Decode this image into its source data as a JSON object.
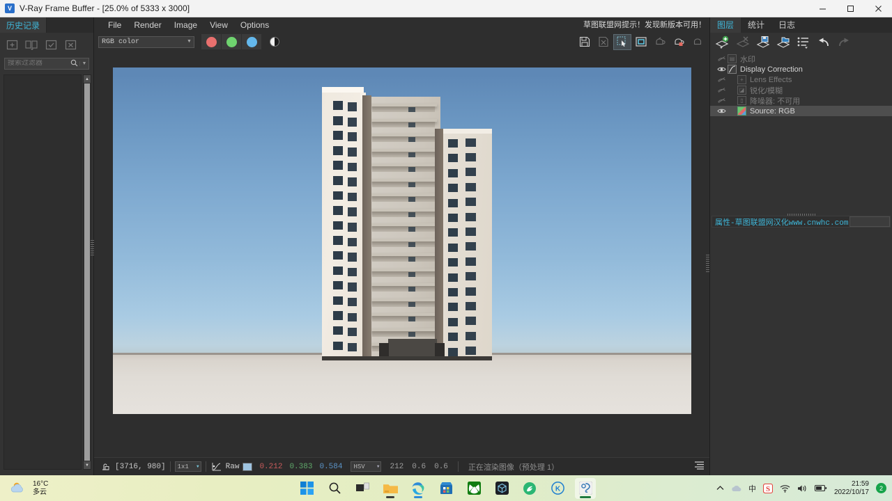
{
  "window": {
    "title": "V-Ray Frame Buffer - [25.0% of 5333 x 3000]",
    "icon": "vray-logo-icon",
    "minimize": "—",
    "maximize": "☐",
    "close": "✕"
  },
  "left_panel": {
    "tab_label": "历史记录",
    "toolbar": [
      {
        "name": "history-add",
        "glyph": "+"
      },
      {
        "name": "history-compare",
        "glyph": "A|B"
      },
      {
        "name": "history-check",
        "glyph": "✓"
      },
      {
        "name": "history-delete",
        "glyph": "✕"
      }
    ],
    "search_placeholder": "搜索过滤器",
    "search_value": ""
  },
  "menubar": {
    "items": [
      "File",
      "Render",
      "Image",
      "View",
      "Options"
    ],
    "update_notice": "草图联盟网提示！发现新版本可用！"
  },
  "toolbar": {
    "channel_select": "RGB color",
    "channels": [
      {
        "name": "red-channel-button",
        "color": "#e9706e"
      },
      {
        "name": "green-channel-button",
        "color": "#6fd36f"
      },
      {
        "name": "blue-channel-button",
        "color": "#64b8ec"
      }
    ],
    "mono_button": "monochrome-toggle",
    "right_tools": [
      {
        "name": "save-image-button",
        "enabled": true
      },
      {
        "name": "save-all-channels-button",
        "enabled": false
      },
      {
        "name": "region-select-button",
        "enabled": true,
        "active": true
      },
      {
        "name": "region-render-button",
        "enabled": true
      },
      {
        "name": "render-last-button",
        "enabled": false
      },
      {
        "name": "render-region-teapot-button",
        "enabled": true
      },
      {
        "name": "stop-render-button",
        "enabled": false
      }
    ]
  },
  "statusbar": {
    "pixel_lock_icon": "pixel-lock-icon",
    "coordinates": "[3716, 980]",
    "sampler_size": "1x1",
    "curve_icon": "curve-icon",
    "raw_label": "Raw",
    "raw_swatch": "#9ec3e0",
    "channel_r": "0.212",
    "channel_g": "0.383",
    "channel_b": "0.584",
    "color_mode": "HSV",
    "hsv_h": "212",
    "hsv_s": "0.6",
    "hsv_v": "0.6",
    "render_status": "正在渲染图像（预处理 1）",
    "log_icon": "log-panel-icon"
  },
  "right_panel": {
    "tabs": [
      {
        "label": "图层",
        "active": true
      },
      {
        "label": "统计",
        "active": false
      },
      {
        "label": "日志",
        "active": false
      }
    ],
    "toolbar": [
      {
        "name": "add-layer-button"
      },
      {
        "name": "delete-layer-button"
      },
      {
        "name": "save-layers-button"
      },
      {
        "name": "load-layers-button"
      },
      {
        "name": "layer-presets-button"
      },
      {
        "name": "undo-button"
      },
      {
        "name": "redo-button"
      }
    ],
    "layers": [
      {
        "label": "水印",
        "visible": false,
        "enabled": false,
        "indent": 0,
        "icon": "watermark-icon",
        "selected": false
      },
      {
        "label": "Display Correction",
        "visible": true,
        "enabled": true,
        "indent": 0,
        "icon": "curve-icon",
        "selected": false
      },
      {
        "label": "Lens Effects",
        "visible": false,
        "enabled": false,
        "indent": 1,
        "icon": "plus-icon",
        "selected": false
      },
      {
        "label": "锐化/模糊",
        "visible": false,
        "enabled": false,
        "indent": 1,
        "icon": "sharpen-icon",
        "selected": false
      },
      {
        "label": "降噪器: 不可用",
        "visible": false,
        "enabled": false,
        "indent": 1,
        "icon": "denoiser-icon",
        "selected": false
      },
      {
        "label": "Source: RGB",
        "visible": true,
        "enabled": true,
        "indent": 1,
        "icon": "source-rgb-icon",
        "selected": true
      }
    ],
    "properties_label": "属性-草图联盟网汉化www.cnwhc.com"
  },
  "render": {
    "description": "High-rise residential tower rendered against a blue sky gradient",
    "sky_top": "#5e88b6",
    "sky_bottom": "#b9c4c2",
    "ground": "#e0dcd6",
    "building_light": "#f0eae0",
    "building_mid": "#cdc7bd",
    "window_color": "#20303e"
  },
  "taskbar": {
    "weather_temp": "16°C",
    "weather_desc": "多云",
    "apps": [
      {
        "name": "start-button",
        "label": "Start"
      },
      {
        "name": "search-button",
        "label": "Search"
      },
      {
        "name": "task-view-button",
        "label": "Task View"
      },
      {
        "name": "file-explorer-button",
        "label": "File Explorer"
      },
      {
        "name": "edge-browser-button",
        "label": "Microsoft Edge"
      },
      {
        "name": "microsoft-store-button",
        "label": "Microsoft Store"
      },
      {
        "name": "xbox-button",
        "label": "Xbox"
      },
      {
        "name": "cube-app-button",
        "label": "3D App"
      },
      {
        "name": "browser-2345-button",
        "label": "Browser"
      },
      {
        "name": "kingsoft-button",
        "label": "K"
      },
      {
        "name": "sketchup-button",
        "label": "SketchUp"
      }
    ],
    "tray": [
      {
        "name": "show-hidden-icons",
        "glyph": "∧"
      },
      {
        "name": "onedrive-icon",
        "glyph": "☁"
      },
      {
        "name": "ime-chinese-icon",
        "glyph": "中"
      },
      {
        "name": "sogou-input-icon",
        "glyph": "S"
      },
      {
        "name": "wifi-icon",
        "glyph": "◠"
      },
      {
        "name": "volume-icon",
        "glyph": "◂"
      },
      {
        "name": "battery-icon",
        "glyph": "▭"
      }
    ],
    "clock_time": "21:59",
    "clock_date": "2022/10/17",
    "notification_count": "2"
  }
}
